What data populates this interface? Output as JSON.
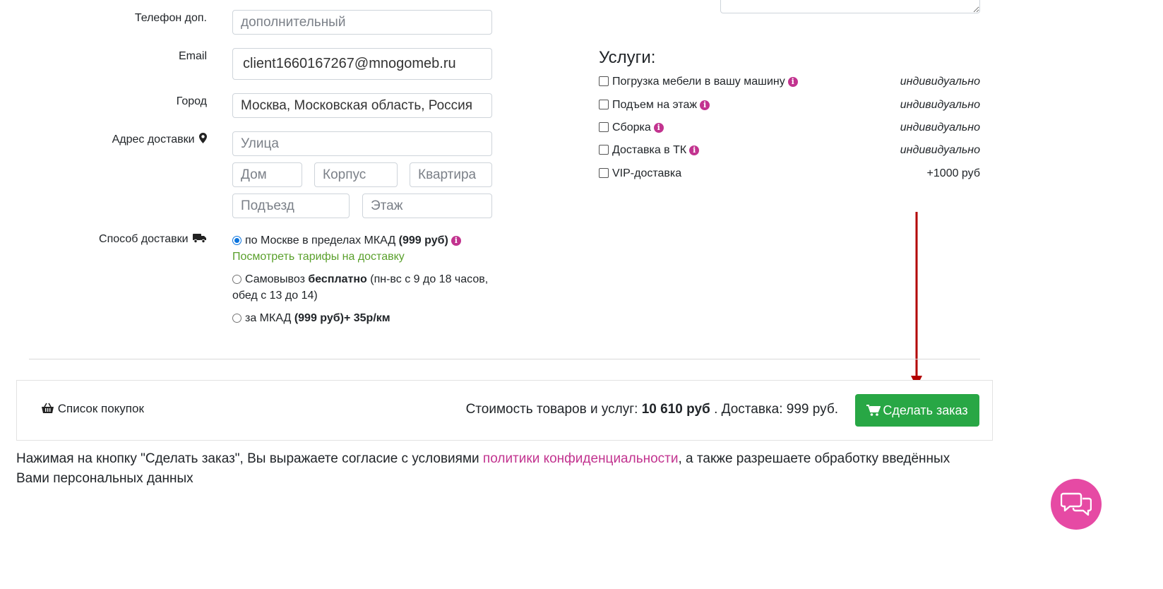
{
  "form": {
    "phone_extra": {
      "label": "Телефон доп.",
      "placeholder": "дополнительный"
    },
    "email": {
      "label": "Email",
      "value": "client1660167267@mnogomeb.ru"
    },
    "city": {
      "label": "Город",
      "value": "Москва, Московская область, Россия"
    },
    "address": {
      "label": "Адрес доставки",
      "street_placeholder": "Улица",
      "house_placeholder": "Дом",
      "building_placeholder": "Корпус",
      "apartment_placeholder": "Квартира",
      "entrance_placeholder": "Подъезд",
      "floor_placeholder": "Этаж"
    },
    "delivery": {
      "label": "Способ доставки",
      "options": [
        {
          "text": "по Москве в пределах МКАД ",
          "bold": "(999 руб)",
          "selected": true
        },
        {
          "text": "Самовывоз ",
          "bold": "бесплатно",
          "rest": " (пн-вс с 9 до 18 часов,",
          "rest2": "обед с 13 до 14)",
          "selected": false
        },
        {
          "text": "за МКАД ",
          "bold": "(999 руб)+ 35р/км",
          "selected": false
        }
      ],
      "tariffs_link": "Посмотреть тарифы на доставку"
    }
  },
  "services": {
    "title": "Услуги:",
    "items": [
      {
        "label": "Погрузка мебели в вашу машину",
        "price": "индивидуально",
        "has_info": true
      },
      {
        "label": "Подъем на этаж",
        "price": "индивидуально",
        "has_info": true
      },
      {
        "label": "Сборка",
        "price": "индивидуально",
        "has_info": true
      },
      {
        "label": "Доставка в ТК",
        "price": "индивидуально",
        "has_info": true
      },
      {
        "label": "VIP-доставка",
        "price": "+1000 руб",
        "has_info": false
      }
    ]
  },
  "footer": {
    "shopping_list": "Список покупок",
    "cost_prefix": "Стоимость товаров и услуг: ",
    "cost_value": "10 610 руб",
    "delivery_text": " . Доставка: 999 руб.",
    "order_button": "Сделать заказ"
  },
  "consent": {
    "before": "Нажимая на кнопку \"Сделать заказ\", Вы выражаете согласие с условиями ",
    "link": "политики конфиденциальности",
    "after": ", а также разрешаете обработку введённых",
    "line2": "Вами персональных данных"
  },
  "colors": {
    "accent_pink": "#c2338f",
    "button_green": "#28a745",
    "link_green": "#5aa02c",
    "annotation_arrow": "#b30000",
    "chat_bubble": "#e64aa4"
  },
  "icons": [
    "info-icon",
    "map-marker-icon",
    "truck-icon",
    "basket-icon",
    "cart-icon",
    "chat-icon",
    "arrow-annotation"
  ]
}
